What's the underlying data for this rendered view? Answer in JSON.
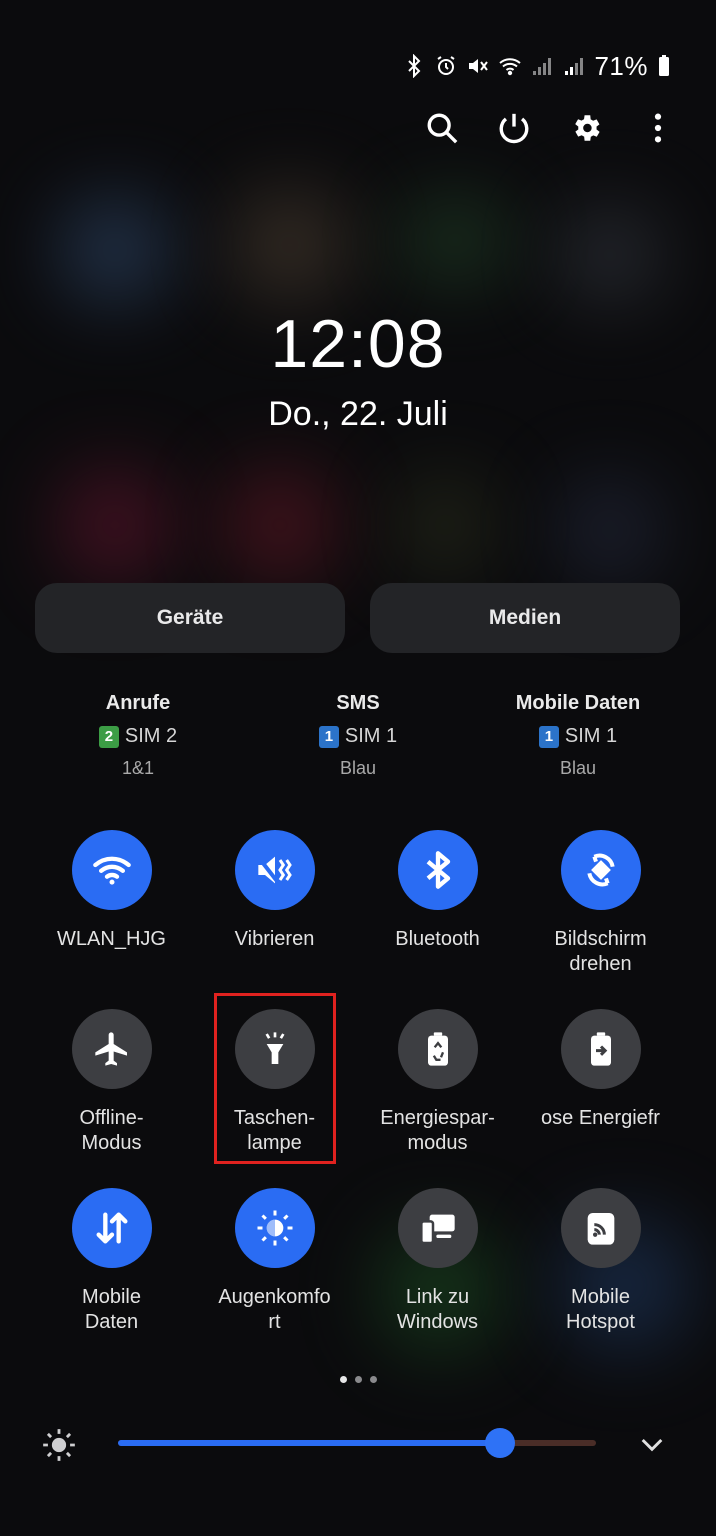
{
  "status_bar": {
    "battery_percent": "71%",
    "icons": [
      "bluetooth-icon",
      "alarm-icon",
      "vibrate-icon",
      "wifi-icon",
      "signal-icon",
      "signal-icon",
      "battery-icon"
    ]
  },
  "top_actions": [
    "search-icon",
    "power-icon",
    "settings-icon",
    "more-icon"
  ],
  "clock": {
    "time": "12:08",
    "date": "Do., 22. Juli"
  },
  "tabs": {
    "devices": "Geräte",
    "media": "Medien"
  },
  "sim": [
    {
      "title": "Anrufe",
      "badge": "2",
      "badge_color": "#3c9d45",
      "sim_label": "SIM 2",
      "carrier": "1&1"
    },
    {
      "title": "SMS",
      "badge": "1",
      "badge_color": "#2b73c9",
      "sim_label": "SIM 1",
      "carrier": "Blau"
    },
    {
      "title": "Mobile Daten",
      "badge": "1",
      "badge_color": "#2b73c9",
      "sim_label": "SIM 1",
      "carrier": "Blau"
    }
  ],
  "tiles": [
    {
      "label": "WLAN_HJG",
      "icon": "wifi-icon",
      "state": "on"
    },
    {
      "label": "Vibrieren",
      "icon": "vibrate-icon",
      "state": "on"
    },
    {
      "label": "Bluetooth",
      "icon": "bluetooth-icon",
      "state": "on"
    },
    {
      "label": "Bildschirm\ndrehen",
      "icon": "rotate-icon",
      "state": "on"
    },
    {
      "label": "Offline-\nModus",
      "icon": "airplane-icon",
      "state": "off"
    },
    {
      "label": "Taschen-\nlampe",
      "icon": "flashlight-icon",
      "state": "off"
    },
    {
      "label": "Energiespar-\nmodus",
      "icon": "battery-saver-icon",
      "state": "off"
    },
    {
      "label": "ose Energiefr",
      "icon": "wireless-powershare-icon",
      "state": "off"
    },
    {
      "label": "Mobile\nDaten",
      "icon": "mobile-data-icon",
      "state": "on"
    },
    {
      "label": "Augenkomfo\nrt",
      "icon": "eye-comfort-icon",
      "state": "on"
    },
    {
      "label": "Link zu\nWindows",
      "icon": "link-windows-icon",
      "state": "off"
    },
    {
      "label": "Mobile\nHotspot",
      "icon": "hotspot-icon",
      "state": "off"
    }
  ],
  "pagination": {
    "pages": 3,
    "current": 1
  },
  "brightness": {
    "level": 0.8
  },
  "colors": {
    "accent": "#2a6cf3",
    "tile_off": "#3d3e42",
    "highlight": "#e0221f"
  }
}
